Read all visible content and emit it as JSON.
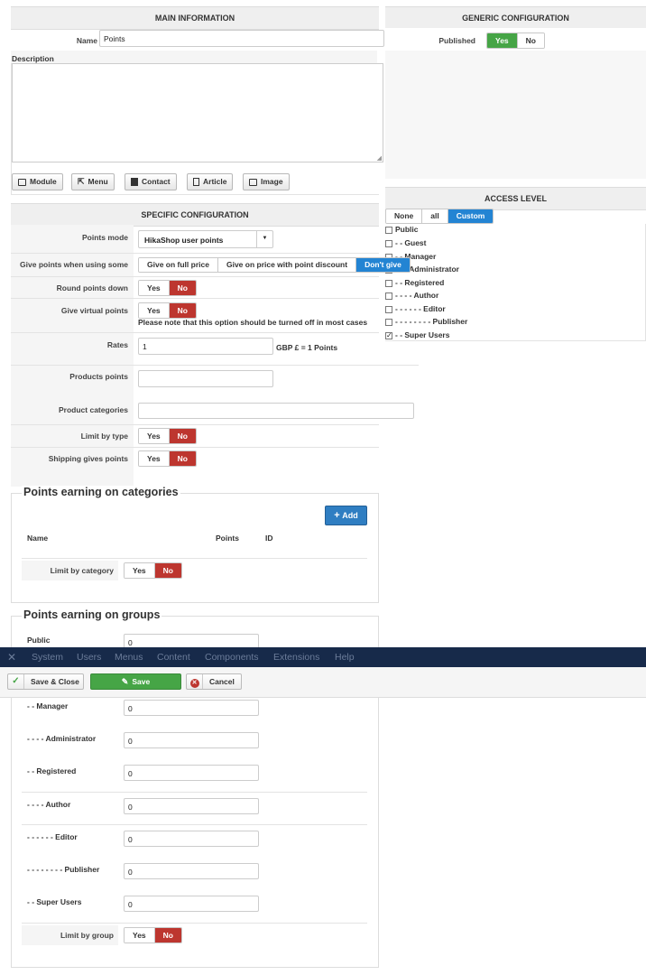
{
  "main_info": {
    "title": "MAIN INFORMATION",
    "name_label": "Name",
    "name_value": "Points",
    "description_label": "Description",
    "editor_buttons": [
      "Module",
      "Menu",
      "Contact",
      "Article",
      "Image"
    ]
  },
  "generic": {
    "title": "GENERIC CONFIGURATION",
    "published_label": "Published",
    "yes": "Yes",
    "no": "No",
    "published": "Yes"
  },
  "access": {
    "title": "ACCESS LEVEL",
    "modes": [
      "None",
      "all",
      "Custom"
    ],
    "selected_mode": "Custom",
    "groups": [
      {
        "label": "Public",
        "checked": false
      },
      {
        "label": "- - Guest",
        "checked": false
      },
      {
        "label": "- - Manager",
        "checked": false
      },
      {
        "label": "- - - Administrator",
        "checked": false
      },
      {
        "label": "- - Registered",
        "checked": false
      },
      {
        "label": "- - - - Author",
        "checked": false
      },
      {
        "label": "- - - - - - Editor",
        "checked": false
      },
      {
        "label": "- - - - - - - - Publisher",
        "checked": false
      },
      {
        "label": "- - Super Users",
        "checked": true
      }
    ]
  },
  "specific": {
    "title": "SPECIFIC CONFIGURATION",
    "points_mode_label": "Points mode",
    "points_mode_value": "HikaShop user points",
    "give_points_label": "Give points when using some",
    "give_points_options": [
      "Give on full price",
      "Give on price with point discount",
      "Don't give"
    ],
    "give_points_selected": "Don't give",
    "round_label": "Round points down",
    "round_value": "No",
    "virtual_label": "Give virtual points",
    "virtual_value": "No",
    "virtual_note": "Please note that this option should be turned off in most cases",
    "rates_label": "Rates",
    "rates_value": "1",
    "rates_suffix": "GBP £ = 1 Points",
    "products_points_label": "Products points",
    "product_categories_label": "Product categories",
    "limit_type_label": "Limit by type",
    "limit_type_value": "No",
    "shipping_label": "Shipping gives points",
    "shipping_value": "No",
    "yes": "Yes",
    "no": "No"
  },
  "categories_box": {
    "title": "Points earning on categories",
    "add_label": "Add",
    "col_name": "Name",
    "col_points": "Points",
    "col_id": "ID",
    "limit_label": "Limit by category",
    "limit_value": "No",
    "yes": "Yes",
    "no": "No"
  },
  "groups_box": {
    "title": "Points earning on groups",
    "rows": [
      {
        "label": "Public",
        "value": "0"
      },
      {
        "label": "- - Manager",
        "value": "0"
      },
      {
        "label": "- - - - Administrator",
        "value": "0"
      },
      {
        "label": "- - Registered",
        "value": "0"
      },
      {
        "label": "- - - - Author",
        "value": "0"
      },
      {
        "label": "- - - - - - Editor",
        "value": "0"
      },
      {
        "label": "- - - - - - - - Publisher",
        "value": "0"
      },
      {
        "label": "- - Super Users",
        "value": "0"
      }
    ],
    "limit_label": "Limit by group",
    "limit_value": "No",
    "yes": "Yes",
    "no": "No"
  },
  "menubar": {
    "items": [
      "System",
      "Users",
      "Menus",
      "Content",
      "Components",
      "Extensions",
      "Help"
    ]
  },
  "toolbar": {
    "save_close": "Save & Close",
    "save": "Save",
    "cancel": "Cancel"
  },
  "colors": {
    "red": "#bd362f",
    "green": "#46a546",
    "blue": "#2384d3",
    "navbar": "#172a4a"
  }
}
